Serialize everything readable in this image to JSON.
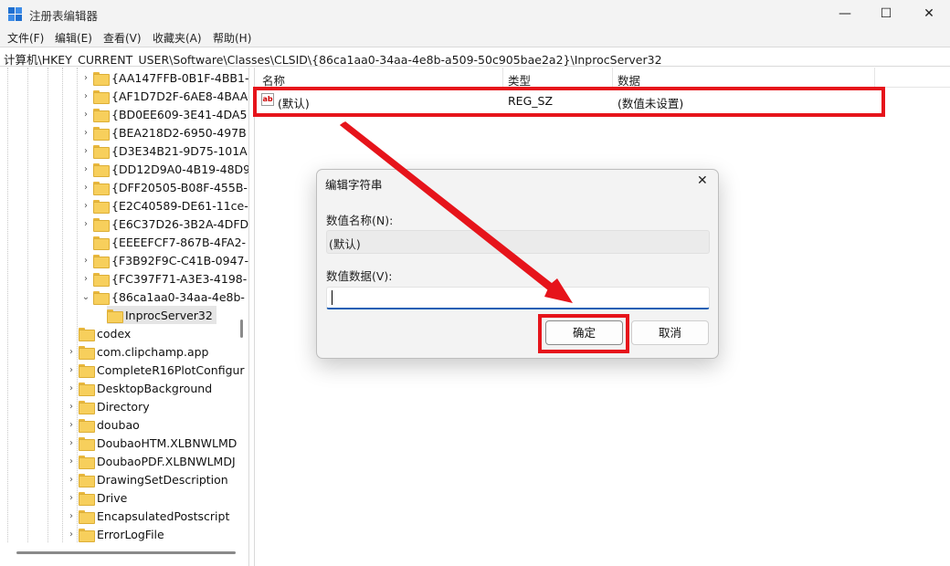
{
  "window": {
    "title": "注册表编辑器",
    "minimize_glyph": "—",
    "maximize_glyph": "☐",
    "close_glyph": "✕"
  },
  "menu": [
    "文件(F)",
    "编辑(E)",
    "查看(V)",
    "收藏夹(A)",
    "帮助(H)"
  ],
  "address": "计算机\\HKEY_CURRENT_USER\\Software\\Classes\\CLSID\\{86ca1aa0-34aa-4e8b-a509-50c905bae2a2}\\InprocServer32",
  "tree": {
    "clsid_items": [
      "{AA147FFB-0B1F-4BB1-",
      "{AF1D7D2F-6AE8-4BAA",
      "{BD0EE609-3E41-4DA5",
      "{BEA218D2-6950-497B",
      "{D3E34B21-9D75-101A",
      "{DD12D9A0-4B19-48D9",
      "{DFF20505-B08F-455B-",
      "{E2C40589-DE61-11ce-",
      "{E6C37D26-3B2A-4DFD",
      "{EEEEFCF7-867B-4FA2-",
      "{F3B92F9C-C41B-0947-",
      "{FC397F71-A3E3-4198-",
      "{86ca1aa0-34aa-4e8b-"
    ],
    "selected_child": "InprocServer32",
    "class_items": [
      "codex",
      "com.clipchamp.app",
      "CompleteR16PlotConfigur",
      "DesktopBackground",
      "Directory",
      "doubao",
      "DoubaoHTM.XLBNWLMD",
      "DoubaoPDF.XLBNWLMDJ",
      "DrawingSetDescription",
      "Drive",
      "EncapsulatedPostscript",
      "ErrorLogFile"
    ]
  },
  "list": {
    "headers": [
      "名称",
      "类型",
      "数据"
    ],
    "row": {
      "name": "(默认)",
      "type": "REG_SZ",
      "data": "(数值未设置)",
      "icon": "ab-string-icon"
    }
  },
  "dialog": {
    "title": "编辑字符串",
    "name_label": "数值名称(N):",
    "name_value": "(默认)",
    "data_label": "数值数据(V):",
    "data_value": "",
    "ok": "确定",
    "cancel": "取消"
  },
  "colors": {
    "highlight": "#e6141b",
    "accent": "#1a5fb4"
  }
}
